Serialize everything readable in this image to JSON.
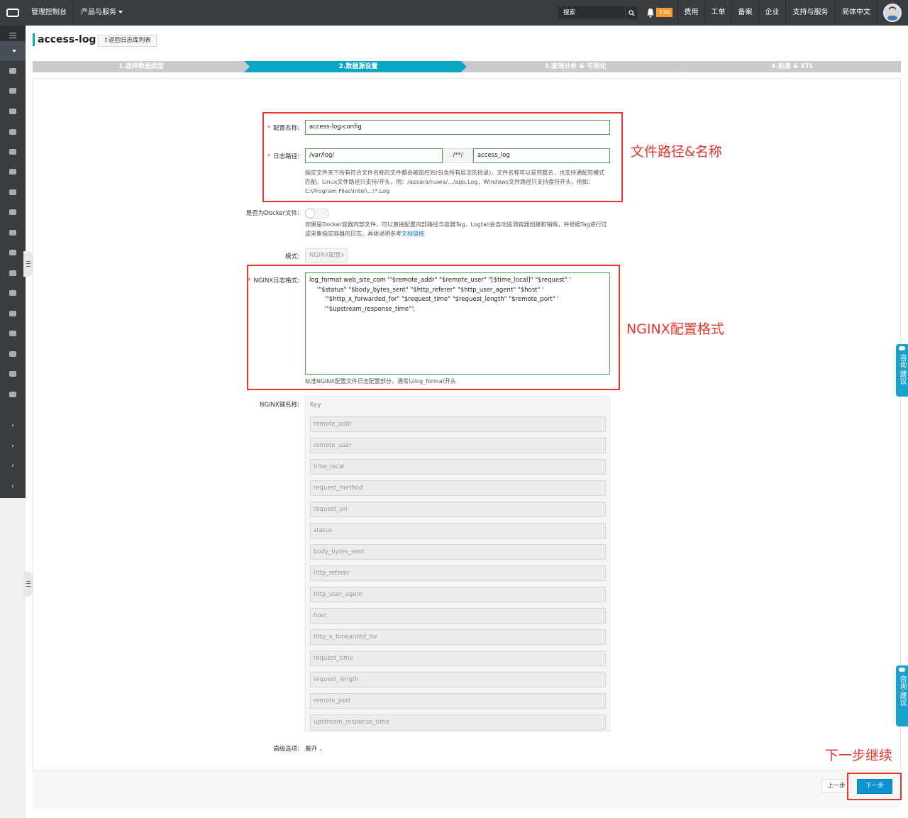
{
  "topbar": {
    "console": "管理控制台",
    "products": "产品与服务",
    "search_placeholder": "搜索",
    "notification_count": "136",
    "items": [
      "费用",
      "工单",
      "备案",
      "企业",
      "支持与服务",
      "简体中文"
    ]
  },
  "header": {
    "title": "access-log",
    "back_label": "返回日志库列表"
  },
  "steps": [
    "1.选择数据类型",
    "2.数据源设置",
    "3.查询分析 & 可视化",
    "4.投递 & ETL"
  ],
  "active_step": 1,
  "form": {
    "config_name_label": "配置名称:",
    "config_name_value": "access-log-config",
    "log_path_label": "日志路径:",
    "log_path_dir": "/var/log/",
    "log_path_sep": "/**/",
    "log_path_file": "access_log",
    "log_path_help": "指定文件夹下所有符合文件名称的文件都会被监控到(包含所有层次的目录)，文件名称可以是完整名，也支持通配符模式匹配。Linux文件路径只支持/开头，例：/apsara/nuwa/.../app.Log，Windows文件路径只支持盘符开头，例如：C:\\Program Files\\Intel\\...\\*.Log",
    "docker_label": "是否为Docker文件:",
    "docker_help": "如果是Docker容器内部文件，可以直接配置内部路径与容器Tag，Logtail会自动监测容器创建和销毁，并根据Tag进行过滤采集指定容器的日志，具体说明参考",
    "docker_help_link": "文档链接",
    "mode_label": "模式:",
    "mode_value": "NGINX配置",
    "nginx_format_label": "NGINX日志格式:",
    "nginx_format_value": "log_format web_site_com '\"$remote_addr\" \"$remote_user\" \"[$time_local]\" \"$request\" '\n    '\"$status\" \"$body_bytes_sent\" \"$http_referer\" \"$http_user_agent\" \"$host\" '\n        '\"$http_x_forwarded_for\" \"$request_time\" \"$request_length\" \"$remote_port\" '\n        '\"$upstream_response_time\"';",
    "nginx_format_help": "标准NGINX配置文件日志配置部分，通常以log_format开头",
    "nginx_keys_label": "NGINX键名称:",
    "keys_header": "Key",
    "keys": [
      "remote_addr",
      "remote_user",
      "time_local",
      "request_method",
      "request_uri",
      "status",
      "body_bytes_sent",
      "http_referer",
      "http_user_agent",
      "host",
      "http_x_forwarded_for",
      "request_time",
      "request_length",
      "remote_port",
      "upstream_response_time"
    ],
    "advanced_label": "高级选项:",
    "advanced_toggle": "展开"
  },
  "footer": {
    "prev": "上一步",
    "next": "下一步"
  },
  "annotations": {
    "file_path": "文件路径&名称",
    "nginx": "NGINX配置格式",
    "next": "下一步继续"
  },
  "consult": {
    "top": "咨询·建议",
    "bottom": "咨询·建议"
  },
  "colors": {
    "topbar": "#373d41",
    "active_step": "#0aa7c5",
    "inactive_step": "#cbcbcb",
    "annotation": "#e8372e",
    "primary_button": "#0d92d2"
  }
}
